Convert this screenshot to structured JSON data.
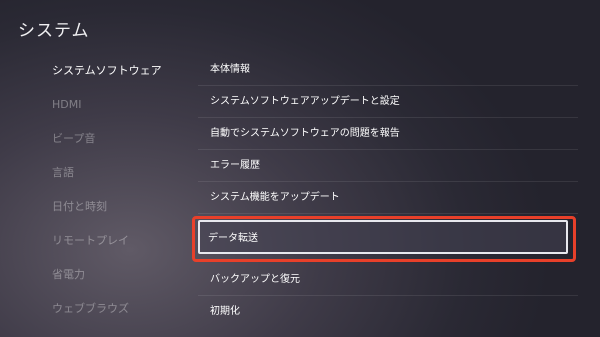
{
  "app": {
    "title": "システム"
  },
  "sidebar": {
    "items": [
      {
        "label": "システムソフトウェア",
        "active": true
      },
      {
        "label": "HDMI",
        "active": false
      },
      {
        "label": "ビープ音",
        "active": false
      },
      {
        "label": "言語",
        "active": false
      },
      {
        "label": "日付と時刻",
        "active": false
      },
      {
        "label": "リモートプレイ",
        "active": false
      },
      {
        "label": "省電力",
        "active": false
      },
      {
        "label": "ウェブブラウズ",
        "active": false
      }
    ]
  },
  "main": {
    "items": [
      {
        "label": "本体情報"
      },
      {
        "label": "システムソフトウェアアップデートと設定"
      },
      {
        "label": "自動でシステムソフトウェアの問題を報告"
      },
      {
        "label": "エラー履歴"
      },
      {
        "label": "システム機能をアップデート"
      },
      {
        "label": "データ転送",
        "focused": true
      },
      {
        "label": "バックアップと復元"
      },
      {
        "label": "初期化"
      }
    ]
  },
  "colors": {
    "highlight": "#e8402a",
    "focus_border": "#e8e8ee"
  }
}
